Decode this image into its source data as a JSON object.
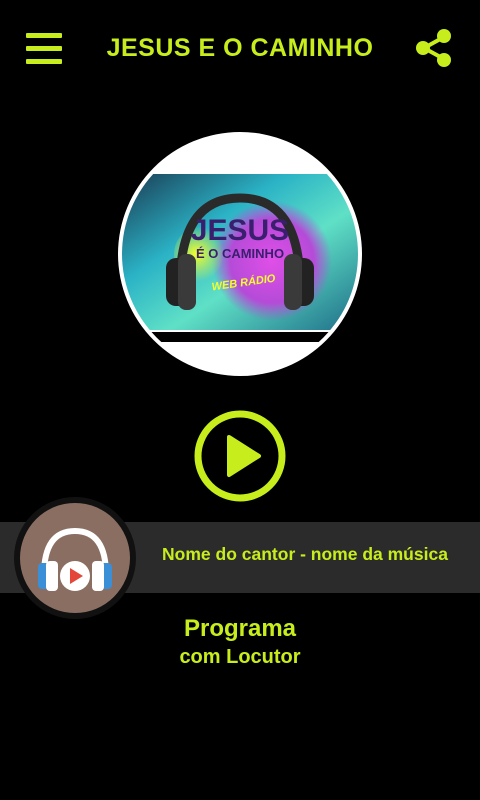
{
  "header": {
    "title": "JESUS E O CAMINHO",
    "menu_icon": "menu-icon",
    "share_icon": "share-icon"
  },
  "logo": {
    "line1": "JESUS",
    "line2": "É O CAMINHO",
    "line3": "WEB RÁDIO"
  },
  "player": {
    "play_icon": "play-icon",
    "now_playing": "Nome do cantor - nome da música"
  },
  "program": {
    "title": "Programa",
    "host": "com Locutor"
  },
  "colors": {
    "accent": "#c7ee1c",
    "background": "#000000",
    "now_bar": "#2b2b2b",
    "cover_bg": "#8a6e62"
  }
}
